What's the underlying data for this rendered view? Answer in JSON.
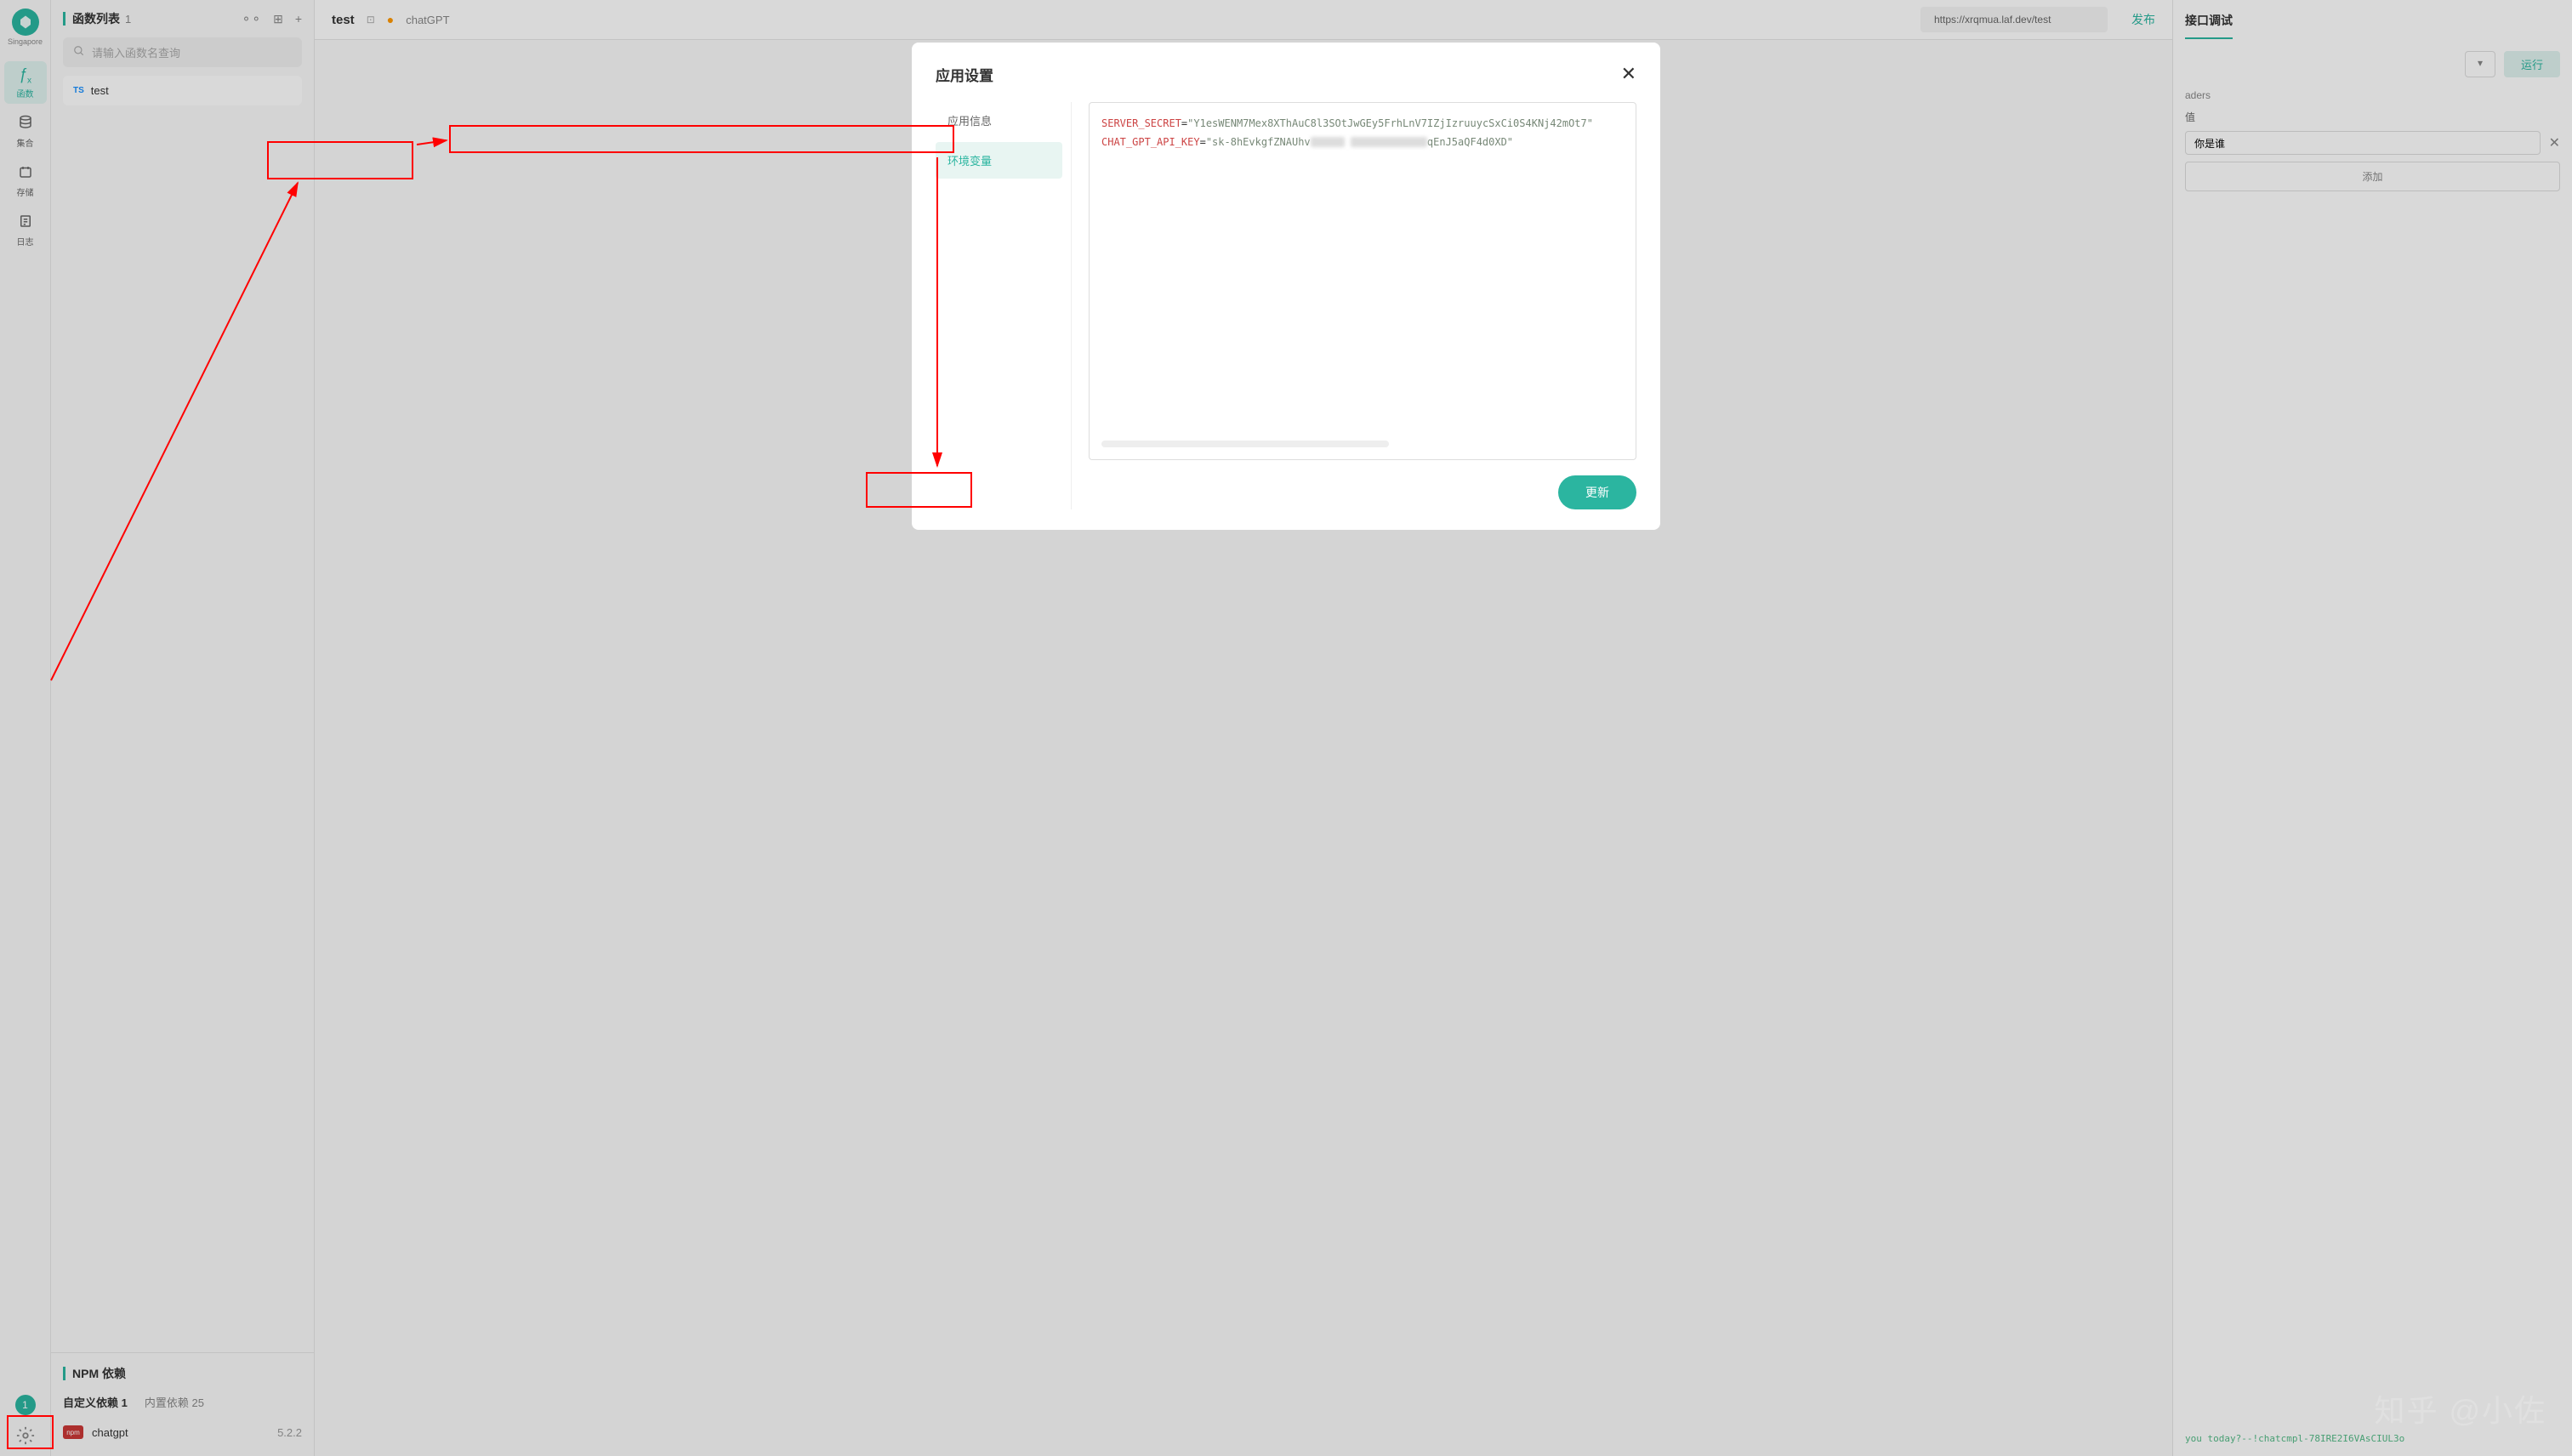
{
  "sidebar": {
    "region": "Singapore",
    "nav": [
      {
        "icon": "fx",
        "label": "函数"
      },
      {
        "icon": "db",
        "label": "集合"
      },
      {
        "icon": "storage",
        "label": "存储"
      },
      {
        "icon": "log",
        "label": "日志"
      }
    ],
    "badge": "1"
  },
  "func_panel": {
    "title": "函数列表",
    "count": "1",
    "search_placeholder": "请输入函数名查询",
    "items": [
      {
        "type": "TS",
        "name": "test"
      }
    ],
    "npm_title": "NPM 依赖",
    "npm_tabs": [
      {
        "label": "自定义依赖",
        "count": "1"
      },
      {
        "label": "内置依赖",
        "count": "25"
      }
    ],
    "npm_items": [
      {
        "name": "chatgpt",
        "version": "5.2.2"
      }
    ]
  },
  "editor": {
    "tab_name": "test",
    "tab_sub": "chatGPT",
    "url": "https://xrqmua.laf.dev/test",
    "publish": "发布"
  },
  "debug": {
    "title": "接口调试",
    "run": "运行",
    "headers_label": "aders",
    "key_label": "值",
    "value": "你是谁",
    "add": "添加",
    "output": "you today?--!chatcmpl-78IRE2I6VAsCIUL3o"
  },
  "modal": {
    "title": "应用设置",
    "nav": [
      {
        "label": "应用信息"
      },
      {
        "label": "环境变量"
      }
    ],
    "env_lines": [
      {
        "key": "SERVER_SECRET",
        "val": "\"Y1esWENM7Mex8XThAuC8l3SOtJwGEy5FrhLnV7IZjIzruuycSxCi0S4KNj42mOt7\""
      },
      {
        "key": "CHAT_GPT_API_KEY",
        "val_a": "\"sk-8hEvkgfZNAUhv",
        "val_b": "qEnJ5aQF4d0XD\""
      }
    ],
    "update": "更新"
  },
  "watermark": "知乎 @小佐"
}
